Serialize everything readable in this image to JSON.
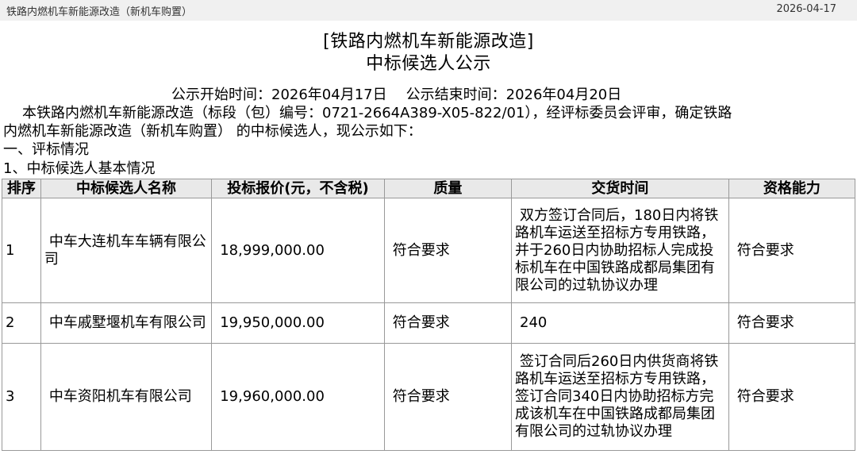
{
  "header": {
    "breadcrumb": "铁路内燃机车新能源改造（新机车购置）",
    "date": "2026-04-17"
  },
  "title": {
    "line1": "[铁路内燃机车新能源改造]",
    "line2": "中标候选人公示"
  },
  "times": {
    "start": "公示开始时间：2026年04月17日",
    "end": "公示结束时间：2026年04月20日"
  },
  "intro": {
    "line1": "本铁路内燃机车新能源改造（标段（包）编号：0721-2664A389-X05-822/01），经评标委员会评审，确定铁路",
    "line2": "内燃机车新能源改造（新机车购置） 的中标候选人，现公示如下："
  },
  "sections": {
    "s1": "一、评标情况",
    "s2": "1、中标候选人基本情况"
  },
  "table": {
    "headers": [
      "排序",
      "中标候选人名称",
      "投标报价(元，不含税)",
      "质量",
      "交货时间",
      "资格能力"
    ],
    "rows": [
      {
        "rank": "1",
        "name": "中车大连机车车辆有限公司",
        "price": "18,999,000.00",
        "quality": "符合要求",
        "delivery": "双方签订合同后，180日内将铁路机车运送至招标方专用铁路，并于260日内协助招标人完成投标机车在中国铁路成都局集团有限公司的过轨协议办理",
        "capability": "符合要求"
      },
      {
        "rank": "2",
        "name": "中车戚墅堰机车有限公司",
        "price": "19,950,000.00",
        "quality": "符合要求",
        "delivery": "240",
        "capability": "符合要求"
      },
      {
        "rank": "3",
        "name": "中车资阳机车有限公司",
        "price": "19,960,000.00",
        "quality": "符合要求",
        "delivery": "签订合同后260日内供货商将铁路机车运送至招标方专用铁路，签订合同340日内协助招标方完成该机车在中国铁路成都局集团有限公司的过轨协议办理",
        "capability": "符合要求"
      }
    ]
  }
}
